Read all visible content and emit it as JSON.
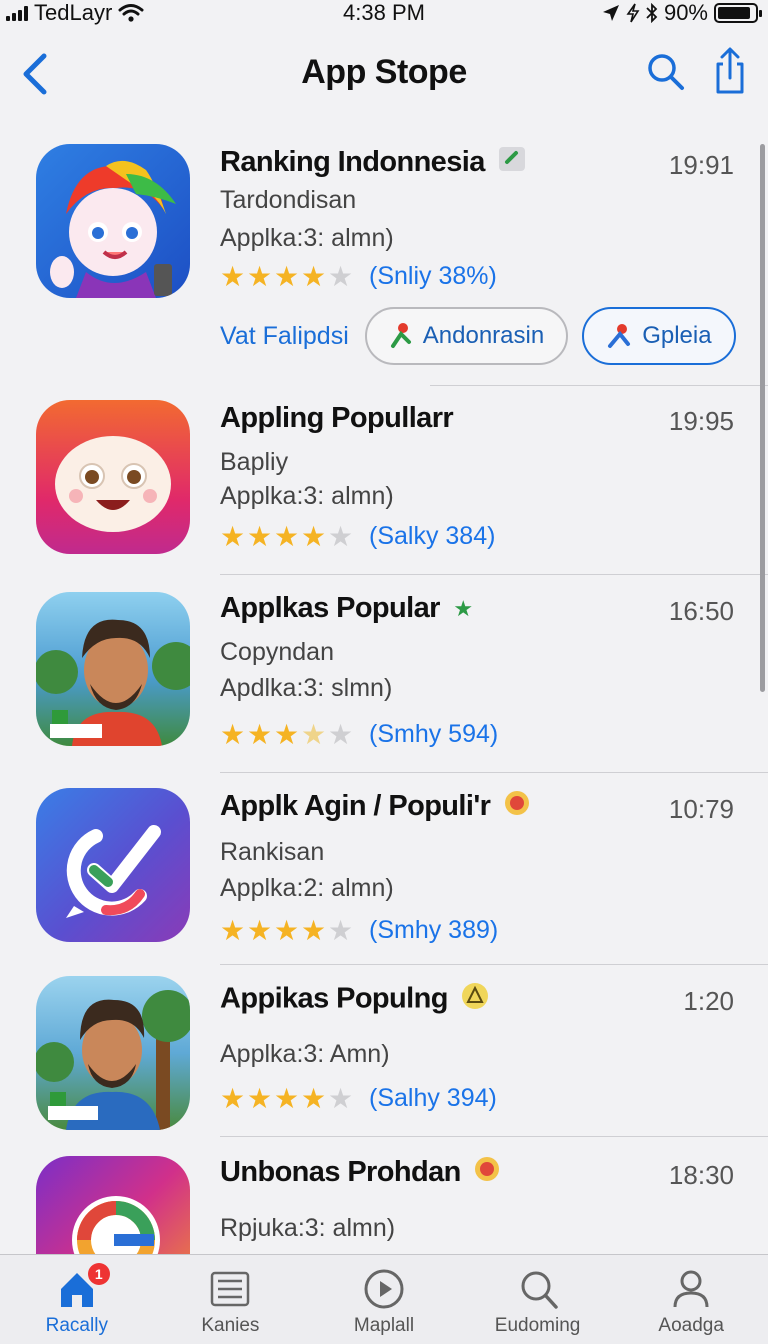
{
  "status_bar": {
    "carrier": "TedLayr",
    "time": "4:38 PM",
    "battery": "90%",
    "battery_level": 0.9
  },
  "nav": {
    "title": "App Stope"
  },
  "featured_actions": {
    "link": "Vat Falipdsi",
    "pill_1": "Andonrasin",
    "pill_2": "Gpleia"
  },
  "apps": [
    {
      "name": "Ranking Indonnesia",
      "category": "Tardondisan",
      "sub": "Applka:3: almn)",
      "time": "19:91",
      "stars": [
        1,
        1,
        1,
        1,
        0
      ],
      "rating": "(Snliy 38%)",
      "badge": "check-badge"
    },
    {
      "name": "Appling Popullarr",
      "category": "Bapliy",
      "sub": "Applka:3: almn)",
      "time": "19:95",
      "stars": [
        1,
        1,
        1,
        1,
        0
      ],
      "rating": "(Salky 384)",
      "badge": ""
    },
    {
      "name": "Applkas Popular",
      "category": "Copyndan",
      "sub": "Apdlka:3: slmn)",
      "time": "16:50",
      "stars": [
        1,
        1,
        1,
        0.5,
        0
      ],
      "rating": "(Smhy 594)",
      "badge": "green-star"
    },
    {
      "name": "Applk Agin / Populi'r",
      "category": "Rankisan",
      "sub": "Applka:2: almn)",
      "time": "10:79",
      "stars": [
        1,
        1,
        1,
        1,
        0
      ],
      "rating": "(Smhy 389)",
      "badge": "red-emoji"
    },
    {
      "name": "Appikas Populng",
      "category": "",
      "sub": "Applka:3: Amn)",
      "time": "1:20",
      "stars": [
        1,
        1,
        1,
        1,
        0
      ],
      "rating": "(Salhy 394)",
      "badge": "yellow-triangle"
    },
    {
      "name": "Unbonas Prohdan",
      "category": "",
      "sub": "Rpjuka:3: almn)",
      "time": "18:30",
      "stars": [],
      "rating": "",
      "badge": "red-emoji"
    }
  ],
  "tabs": [
    {
      "label": "Racally",
      "badge": "1",
      "icon": "house-icon",
      "active": true
    },
    {
      "label": "Kanies",
      "icon": "list-icon"
    },
    {
      "label": "Maplall",
      "icon": "play-circle-icon"
    },
    {
      "label": "Eudoming",
      "icon": "search-icon"
    },
    {
      "label": "Aoadga",
      "icon": "person-icon"
    }
  ],
  "colors": {
    "accent": "#1a6ed8",
    "star": "#f5b323",
    "background": "#f2f2f4"
  }
}
